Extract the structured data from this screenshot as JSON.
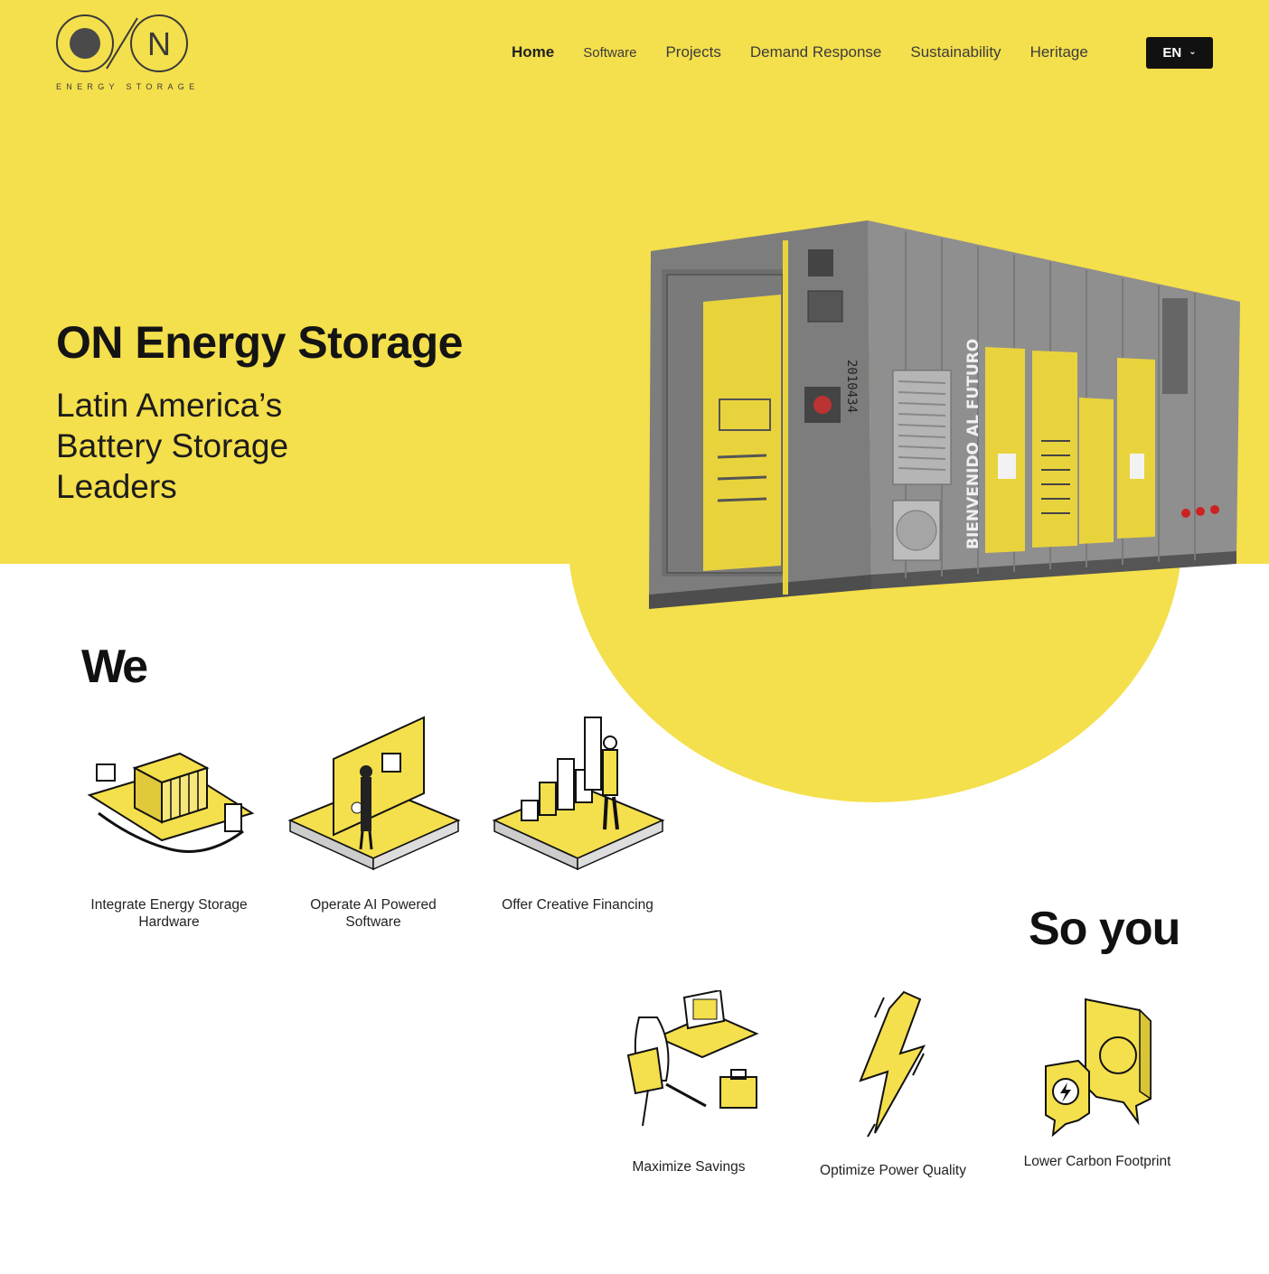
{
  "brand": {
    "logo_letter": "N",
    "tagline": "ENERGY STORAGE",
    "accent_color": "#f4df4c",
    "dark_color": "#111111"
  },
  "nav": {
    "items": [
      {
        "label": "Home"
      },
      {
        "label": "Software"
      },
      {
        "label": "Projects"
      },
      {
        "label": "Demand Response"
      },
      {
        "label": "Sustainability"
      },
      {
        "label": "Heritage"
      }
    ],
    "language": "EN"
  },
  "hero": {
    "title": "ON Energy Storage",
    "subtitle": "Latin America’s Battery Storage Leaders",
    "container_banner": "BIENVENIDO AL FUTURO",
    "container_serial": "2010434"
  },
  "we": {
    "title": "We",
    "items": [
      {
        "label": "Integrate Energy Storage Hardware",
        "icon": "battery-hardware-icon"
      },
      {
        "label": "Operate AI Powered Software",
        "icon": "ai-software-icon"
      },
      {
        "label": "Offer Creative Financing",
        "icon": "financing-chart-icon"
      }
    ]
  },
  "so_you": {
    "title": "So you",
    "items": [
      {
        "label": "Maximize Savings",
        "icon": "workspace-savings-icon"
      },
      {
        "label": "Optimize Power Quality",
        "icon": "lightning-bolt-icon"
      },
      {
        "label": "Lower Carbon Footprint",
        "icon": "chat-bubbles-icon"
      }
    ]
  }
}
